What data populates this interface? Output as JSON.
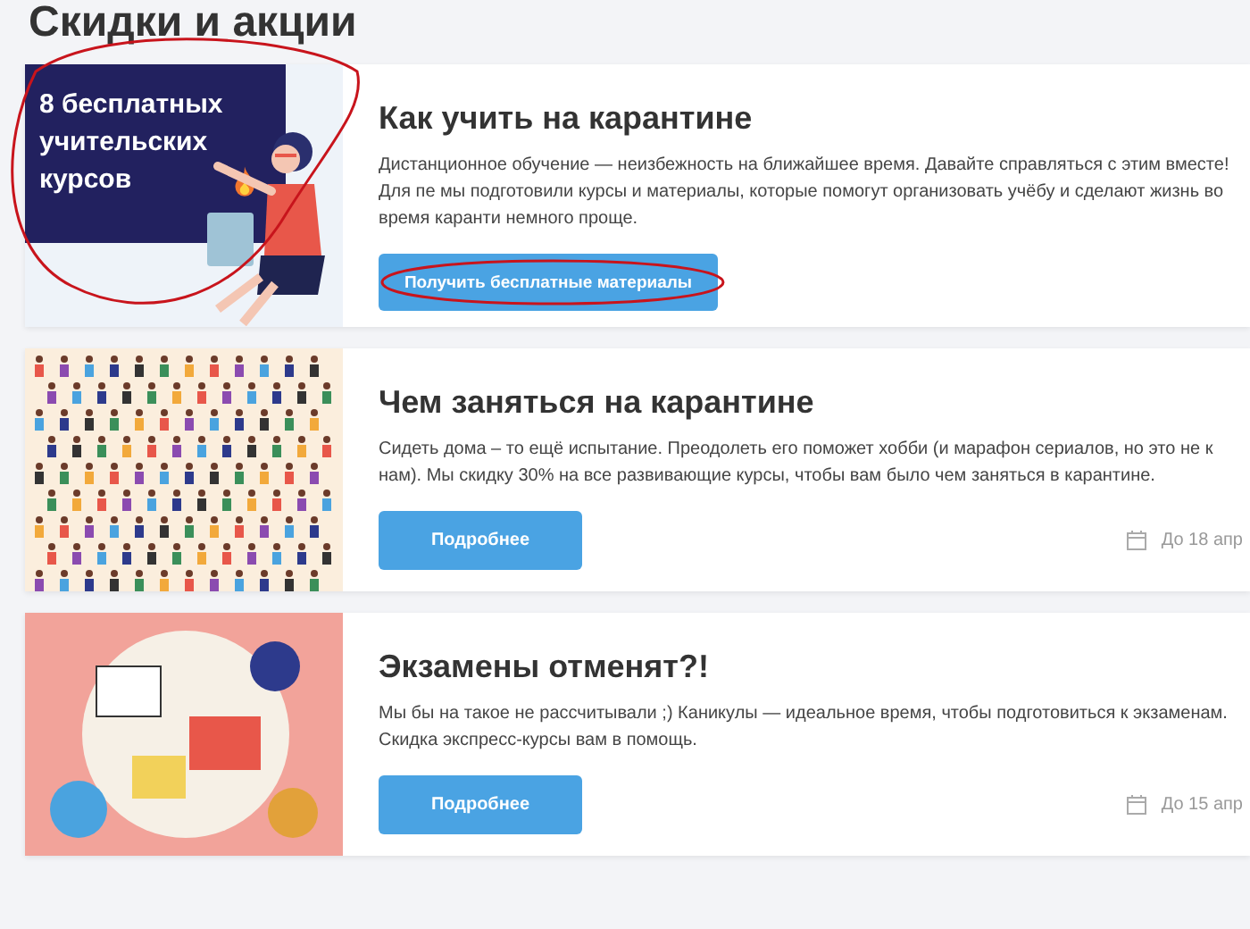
{
  "section_title": "Скидки и акции",
  "promos": [
    {
      "kind": "banner",
      "banner_text": "8 бесплатных учительских курсов",
      "title": "Как учить на карантине",
      "description": "Дистанционное обучение — неизбежность на ближайшее время. Давайте справляться с этим вместе! Для пе мы подготовили курсы и материалы, которые помогут организовать учёбу и сделают жизнь во время каранти немного проще.",
      "button": "Получить бесплатные материалы"
    },
    {
      "kind": "crowd",
      "title": "Чем заняться на карантине",
      "description": "Сидеть дома – то ещё испытание. Преодолеть его поможет хобби (и марафон сериалов, но это не к нам). Мы скидку 30% на все развивающие курсы, чтобы вам было чем заняться в карантине.",
      "button": "Подробнее",
      "deadline": "До 18 апр"
    },
    {
      "kind": "desk",
      "title": "Экзамены отменят?!",
      "description": "Мы бы на такое не рассчитывали ;) Каникулы — идеальное время, чтобы подготовиться к экзаменам. Скидка экспресс-курсы вам в помощь.",
      "button": "Подробнее",
      "deadline": "До 15 апр"
    }
  ]
}
